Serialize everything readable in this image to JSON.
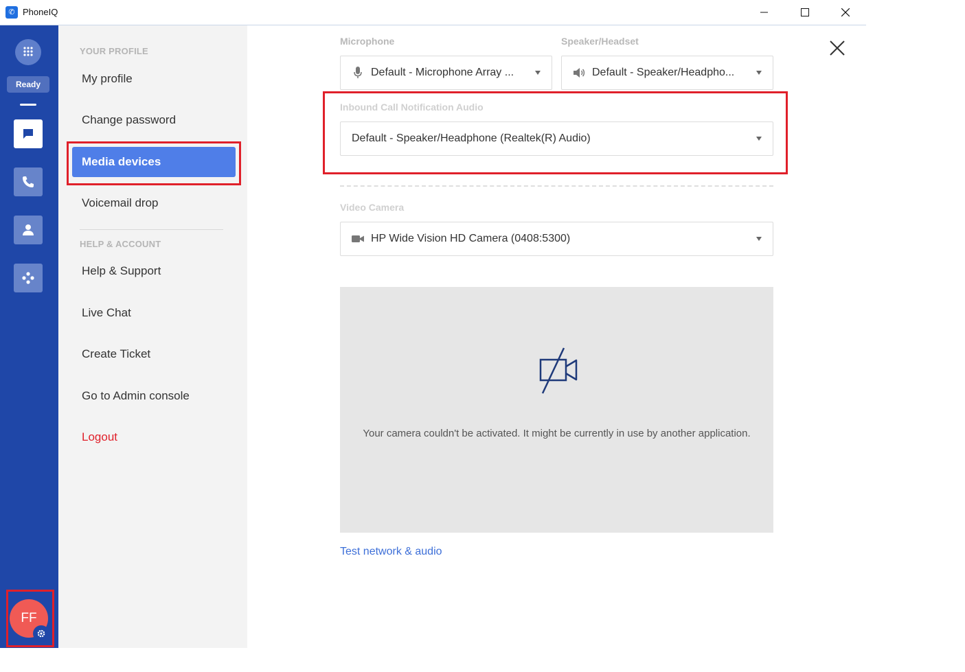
{
  "window": {
    "title": "PhoneIQ",
    "logo_glyph": "✆"
  },
  "rail": {
    "status": "Ready",
    "avatar_initials": "FF",
    "icons": [
      "dialpad-icon",
      "chat-icon",
      "phone-icon",
      "contact-icon",
      "integrations-icon",
      "gear-icon"
    ]
  },
  "menu": {
    "section_profile": "YOUR PROFILE",
    "my_profile": "My profile",
    "change_password": "Change password",
    "media_devices": "Media devices",
    "voicemail_drop": "Voicemail drop",
    "section_help": "HELP & ACCOUNT",
    "help_support": "Help & Support",
    "live_chat": "Live Chat",
    "create_ticket": "Create Ticket",
    "admin_console": "Go to Admin console",
    "logout": "Logout"
  },
  "media": {
    "microphone_label": "Microphone",
    "microphone_value": "Default - Microphone Array ...",
    "speaker_label": "Speaker/Headset",
    "speaker_value": "Default - Speaker/Headpho...",
    "inbound_label": "Inbound Call Notification Audio",
    "inbound_value": "Default - Speaker/Headphone (Realtek(R) Audio)",
    "camera_label": "Video Camera",
    "camera_value": "HP Wide Vision HD Camera (0408:5300)",
    "camera_error": "Your camera couldn't be activated. It might be currently in use by another application.",
    "test_link": "Test network & audio"
  },
  "colors": {
    "rail": "#1f47a8",
    "accent": "#4f7ee8",
    "highlight_box": "#e0202a",
    "avatar": "#f05a55",
    "logout": "#e0202a",
    "link": "#3d6fd8"
  }
}
